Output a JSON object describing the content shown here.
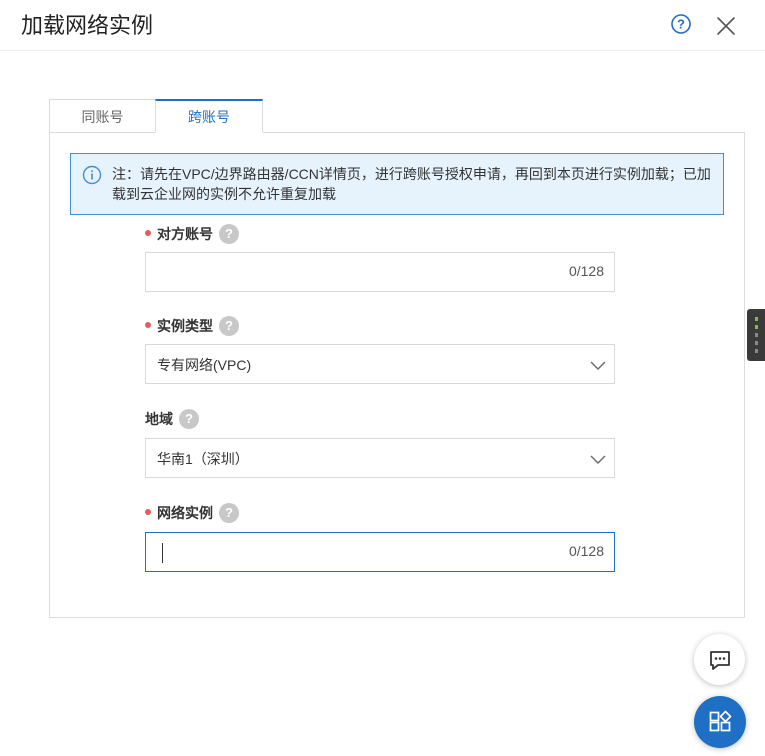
{
  "dialog": {
    "title": "加载网络实例",
    "help_icon": "question-circle-icon",
    "close_icon": "close-icon"
  },
  "tabs": [
    {
      "label": "同账号",
      "active": false
    },
    {
      "label": "跨账号",
      "active": true
    }
  ],
  "notice": {
    "icon": "info-icon",
    "text": "注：请先在VPC/边界路由器/CCN详情页，进行跨账号授权申请，再回到本页进行实例加载；已加载到云企业网的实例不允许重复加载"
  },
  "form": {
    "peer_account": {
      "label": "对方账号",
      "value": "",
      "counter": "0/128"
    },
    "instance_type": {
      "label": "实例类型",
      "value": "专有网络(VPC)"
    },
    "region": {
      "label": "地域",
      "value": "华南1（深圳）"
    },
    "network_instance": {
      "label": "网络实例",
      "value": "",
      "counter": "0/128"
    }
  },
  "colors": {
    "accent": "#1f6fc5",
    "required": "#e85a5a",
    "notice_bg": "#e6f3fc"
  }
}
